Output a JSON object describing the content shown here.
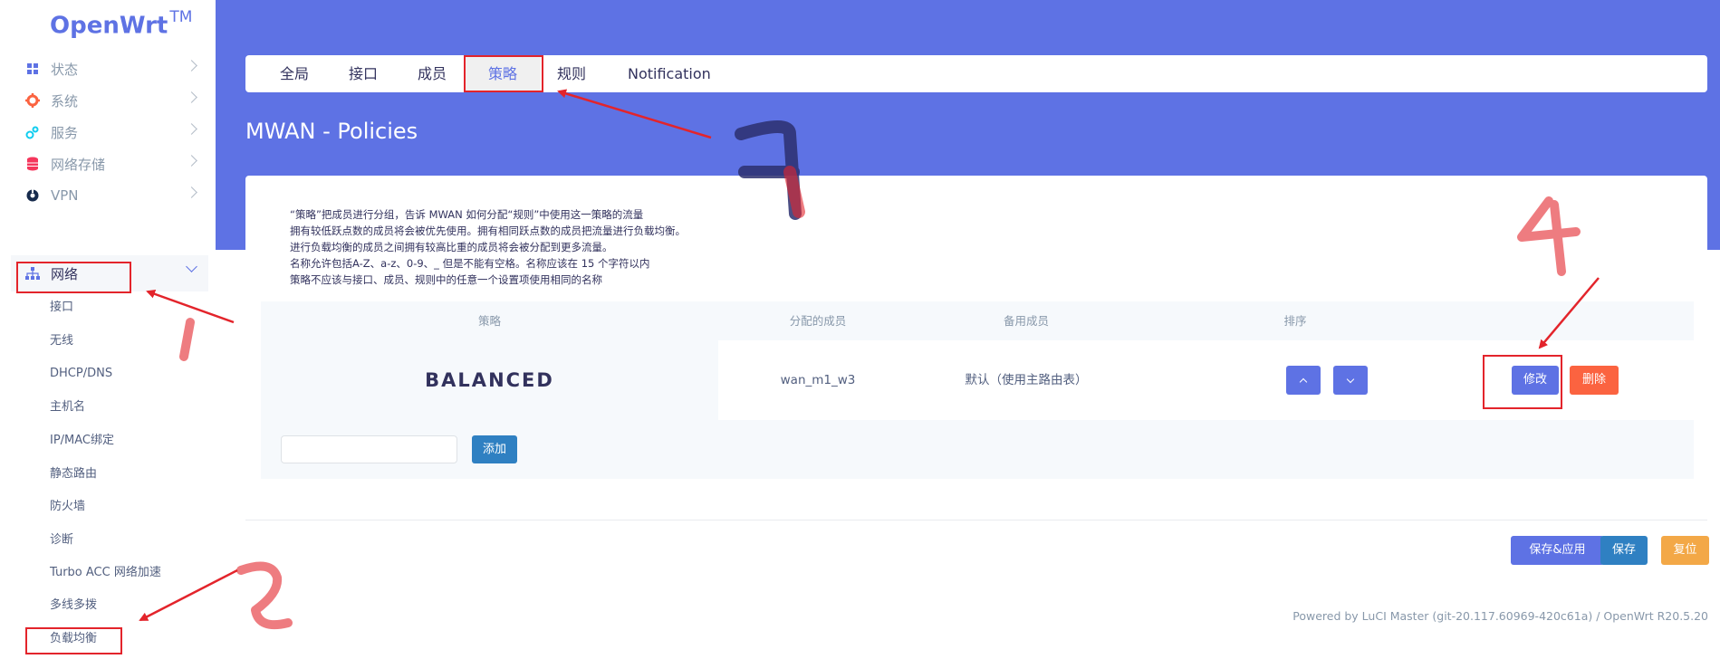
{
  "brand": {
    "name": "OpenWrt",
    "tm": "TM"
  },
  "sidebar": {
    "items": [
      {
        "label": "状态",
        "icon": "dashboard-icon"
      },
      {
        "label": "系统",
        "icon": "gear-icon"
      },
      {
        "label": "服务",
        "icon": "services-icon"
      },
      {
        "label": "网络存储",
        "icon": "database-icon"
      },
      {
        "label": "VPN",
        "icon": "vpn-icon"
      },
      {
        "label": "网络",
        "icon": "network-icon"
      }
    ],
    "subitems": [
      "接口",
      "无线",
      "DHCP/DNS",
      "主机名",
      "IP/MAC绑定",
      "静态路由",
      "防火墙",
      "诊断",
      "Turbo ACC 网络加速",
      "多线多拨",
      "负载均衡"
    ]
  },
  "tabs": [
    "全局",
    "接口",
    "成员",
    "策略",
    "规则",
    "Notification"
  ],
  "page": {
    "title": "MWAN - Policies"
  },
  "description": [
    "“策略”把成员进行分组，告诉 MWAN 如何分配“规则”中使用这一策略的流量",
    "拥有较低跃点数的成员将会被优先使用。拥有相同跃点数的成员把流量进行负载均衡。",
    "进行负载均衡的成员之间拥有较高比重的成员将会被分配到更多流量。",
    "名称允许包括A-Z、a-z、0-9、_ 但是不能有空格。名称应该在 15 个字符以内",
    "策略不应该与接口、成员、规则中的任意一个设置项使用相同的名称"
  ],
  "table": {
    "headers": [
      "策略",
      "分配的成员",
      "备用成员",
      "排序"
    ],
    "rows": [
      {
        "name": "BALANCED",
        "members": "wan_m1_w3",
        "fallback": "默认（使用主路由表）"
      }
    ],
    "edit_label": "修改",
    "delete_label": "删除",
    "add_label": "添加"
  },
  "actions": {
    "save_apply": "保存&应用",
    "save": "保存",
    "reset": "复位"
  },
  "footer": "Powered by LuCI Master (git-20.117.60969-420c61a) / OpenWrt R20.5.20",
  "colors": {
    "accent": "#5e72e4",
    "danger": "#fb6340",
    "info": "#2f80c2",
    "warning": "#f3a847",
    "annotation": "#e3242b"
  },
  "annotations": [
    "1",
    "2",
    "3",
    "4"
  ]
}
